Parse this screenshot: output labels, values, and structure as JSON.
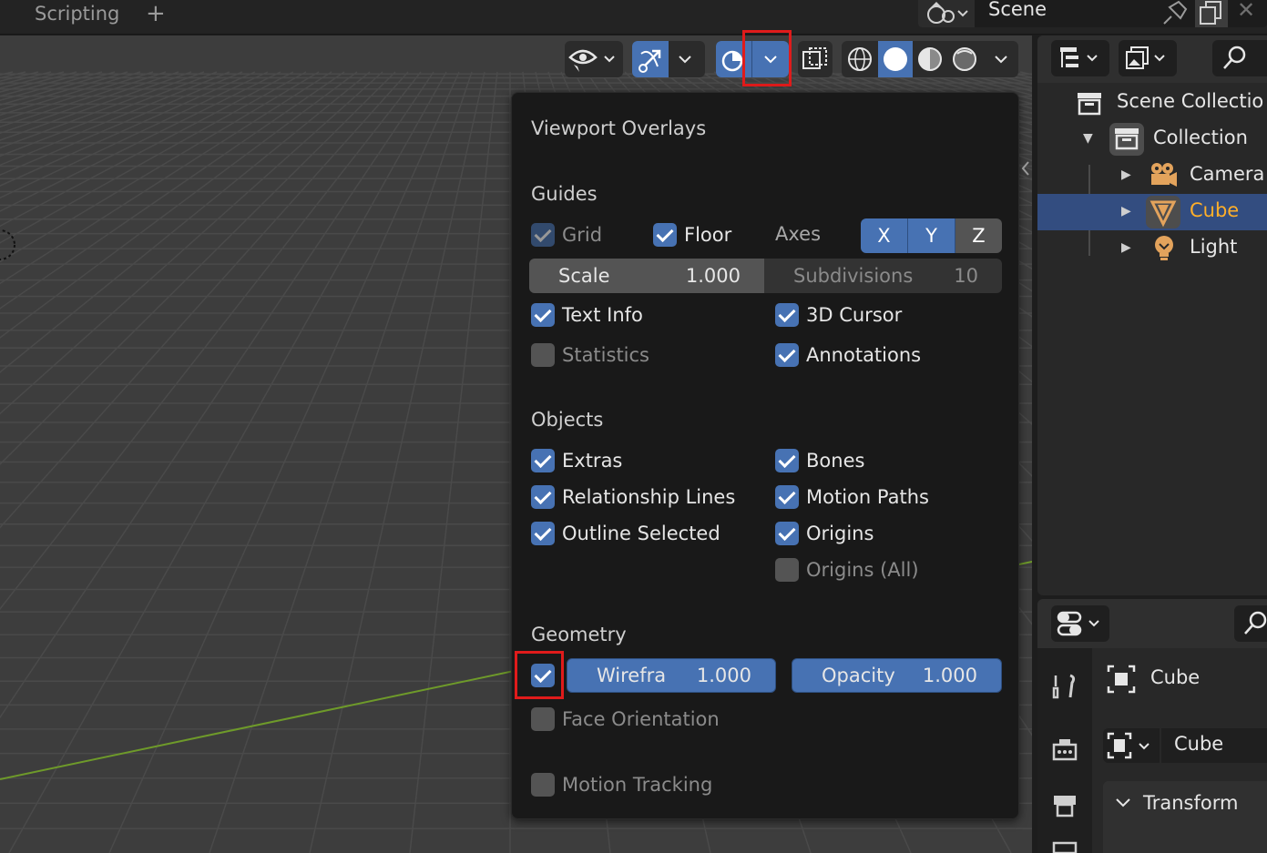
{
  "topbar": {
    "workspace_tab": "Scripting",
    "add_workspace": "+",
    "scene_name": "Scene",
    "close": "✕"
  },
  "popup": {
    "title": "Viewport Overlays",
    "guides": {
      "heading": "Guides",
      "grid": {
        "label": "Grid",
        "checked": true,
        "disabled": true
      },
      "floor": {
        "label": "Floor",
        "checked": true
      },
      "axes_label": "Axes",
      "axes": [
        {
          "label": "X",
          "on": true
        },
        {
          "label": "Y",
          "on": true
        },
        {
          "label": "Z",
          "on": false
        }
      ],
      "scale": {
        "label": "Scale",
        "value": "1.000"
      },
      "subdivisions": {
        "label": "Subdivisions",
        "value": "10"
      },
      "text_info": {
        "label": "Text Info",
        "checked": true
      },
      "cursor_3d": {
        "label": "3D Cursor",
        "checked": true
      },
      "statistics": {
        "label": "Statistics",
        "checked": false
      },
      "annotations": {
        "label": "Annotations",
        "checked": true
      }
    },
    "objects": {
      "heading": "Objects",
      "extras": {
        "label": "Extras",
        "checked": true
      },
      "bones": {
        "label": "Bones",
        "checked": true
      },
      "relationship_lines": {
        "label": "Relationship Lines",
        "checked": true
      },
      "motion_paths": {
        "label": "Motion Paths",
        "checked": true
      },
      "outline_selected": {
        "label": "Outline Selected",
        "checked": true
      },
      "origins": {
        "label": "Origins",
        "checked": true
      },
      "origins_all": {
        "label": "Origins (All)",
        "checked": false
      }
    },
    "geometry": {
      "heading": "Geometry",
      "wireframe": {
        "checked": true,
        "label": "Wirefra",
        "value": "1.000"
      },
      "opacity": {
        "label": "Opacity",
        "value": "1.000"
      },
      "face_orientation": {
        "label": "Face Orientation",
        "checked": false
      }
    },
    "motion_tracking": {
      "label": "Motion Tracking",
      "checked": false
    }
  },
  "outliner": {
    "items": [
      {
        "label": "Scene Collectio",
        "icon": "scene-collection-icon"
      },
      {
        "label": "Collection",
        "icon": "collection-icon",
        "expanded": true
      },
      {
        "label": "Camera",
        "icon": "camera-icon"
      },
      {
        "label": "Cube",
        "icon": "mesh-icon",
        "selected": true
      },
      {
        "label": "Light",
        "icon": "light-icon"
      }
    ]
  },
  "properties": {
    "object_name": "Cube",
    "data_name": "Cube",
    "panel_transform": "Transform"
  },
  "colors": {
    "accent": "#4772b3",
    "selection": "#334d80",
    "highlight": "#e01b1b",
    "active_text": "#ffaf29"
  }
}
